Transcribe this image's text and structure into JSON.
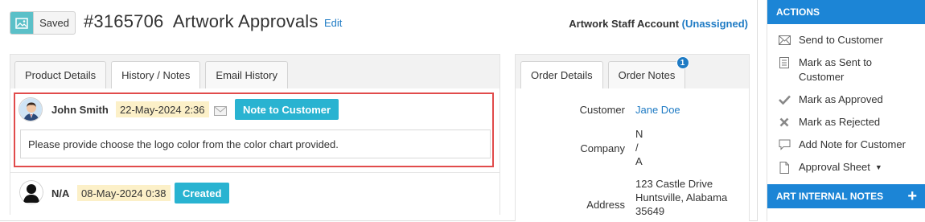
{
  "header": {
    "saved_label": "Saved",
    "title": "#3165706  Artwork Approvals",
    "edit_label": "Edit",
    "staff_label": "Artwork Staff Account",
    "staff_value": "(Unassigned)"
  },
  "left_tabs": [
    "Product Details",
    "History / Notes",
    "Email History"
  ],
  "notes": [
    {
      "author": "John Smith",
      "date": "22-May-2024 2:36",
      "label": "Note to Customer",
      "text": "Please provide choose the logo color from the color chart provided."
    },
    {
      "author": "N/A",
      "date": "08-May-2024 0:38",
      "label": "Created"
    }
  ],
  "right_tabs": {
    "order_details": "Order Details",
    "order_notes": "Order Notes",
    "order_notes_count": "1"
  },
  "order": {
    "customer_label": "Customer",
    "customer_value": "Jane Doe",
    "company_label": "Company",
    "company_lines": [
      "N",
      "/",
      "A"
    ],
    "address_label": "Address",
    "address_lines": [
      "123 Castle Drive",
      "Huntsville, Alabama",
      "35649"
    ]
  },
  "sidebar": {
    "actions_title": "ACTIONS",
    "items": [
      {
        "label": "Send to Customer",
        "icon": "envelope-icon"
      },
      {
        "label": "Mark as Sent to Customer",
        "icon": "document-list-icon"
      },
      {
        "label": "Mark as Approved",
        "icon": "checkmark-icon"
      },
      {
        "label": "Mark as Rejected",
        "icon": "x-icon"
      },
      {
        "label": "Add Note for Customer",
        "icon": "speech-bubble-icon"
      },
      {
        "label": "Approval Sheet",
        "icon": "file-icon"
      }
    ],
    "internal_notes_title": "ART INTERNAL NOTES"
  },
  "colors": {
    "accent_blue": "#1c85d6",
    "badge_teal": "#29b3d1",
    "date_highlight": "#fcf0c8",
    "highlight_border": "#e14b4b",
    "link": "#1f7bc4"
  }
}
